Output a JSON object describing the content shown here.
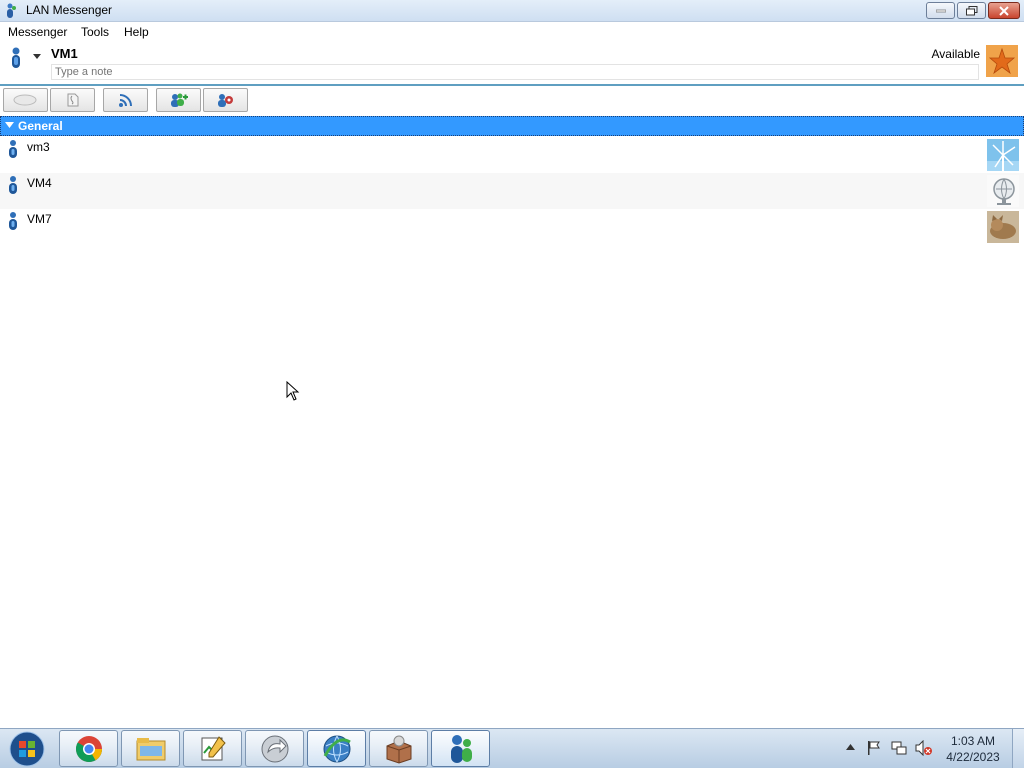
{
  "window": {
    "title": "LAN Messenger"
  },
  "menu": {
    "items": [
      "Messenger",
      "Tools",
      "Help"
    ]
  },
  "profile": {
    "name": "VM1",
    "note_placeholder": "Type a note",
    "status": "Available"
  },
  "toolbar": {
    "buttons": [
      "chat-icon",
      "file-transfer-icon",
      "broadcast-icon",
      "add-contact-icon",
      "settings-icon"
    ]
  },
  "group": {
    "label": "General"
  },
  "contacts": [
    {
      "name": "vm3",
      "avatar": "windmill-avatar-icon"
    },
    {
      "name": "VM4",
      "avatar": "globe-avatar-icon"
    },
    {
      "name": "VM7",
      "avatar": "cat-avatar-icon"
    }
  ],
  "taskbar": {
    "clock_time": "1:03 AM",
    "clock_date": "4/22/2023",
    "apps": [
      "chrome-icon",
      "file-explorer-icon",
      "task-manager-icon",
      "app-arrow-icon",
      "internet-icon",
      "package-icon",
      "lan-messenger-icon"
    ]
  },
  "colors": {
    "group_header": "#3399ff",
    "accent_line": "#5f9fc1"
  }
}
